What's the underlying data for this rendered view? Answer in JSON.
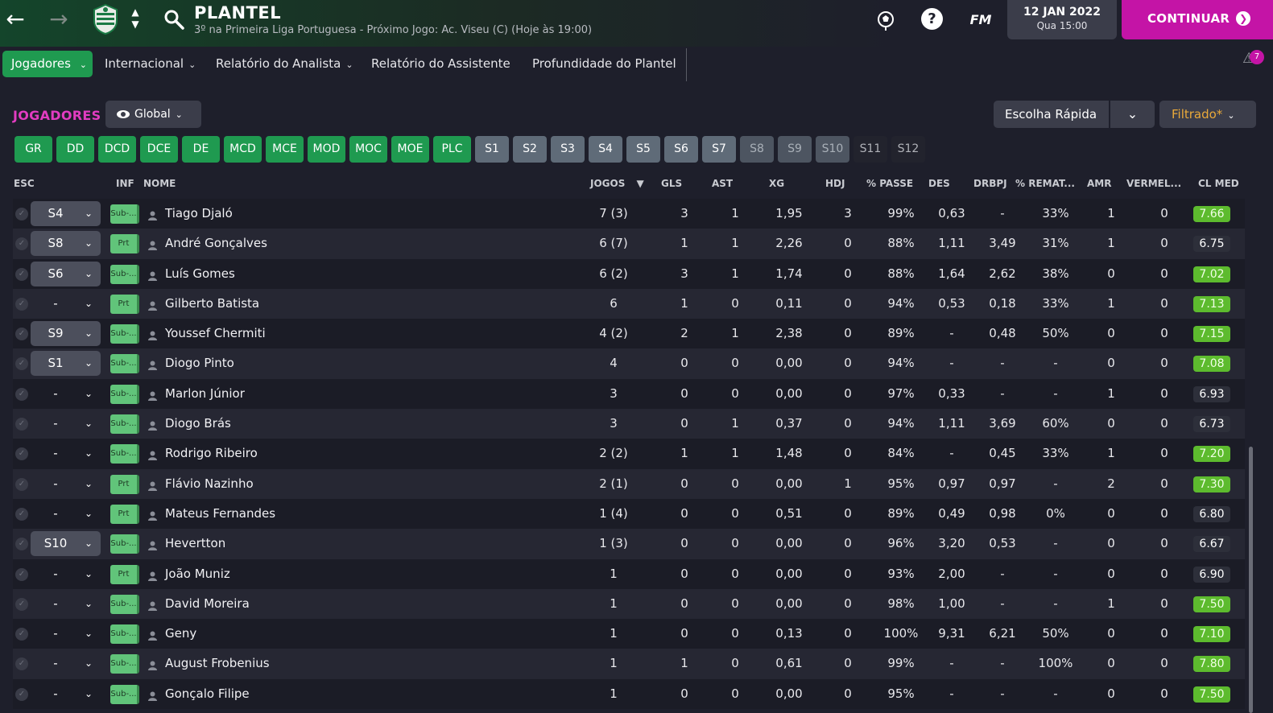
{
  "header": {
    "title": "PLANTEL",
    "subtitle": "3º na Primeira Liga Portuguesa - Próximo Jogo: Ac. Viseu (C) (Hoje às 19:00)",
    "fm_logo": "FM",
    "help": "?",
    "date": "12 JAN 2022",
    "time": "Qua 15:00",
    "continue_label": "CONTINUAR"
  },
  "nav": {
    "tabs": [
      {
        "label": "Jogadores"
      },
      {
        "label": "Internacional"
      },
      {
        "label": "Relatório do Analista"
      },
      {
        "label": "Relatório do Assistente"
      },
      {
        "label": "Profundidade do Plantel"
      }
    ],
    "notification_count": "7"
  },
  "filters": {
    "section_label": "JOGADORES",
    "view": "Global",
    "quick_pick": "Escolha Rápida",
    "filter_label": "Filtrado*",
    "positions": [
      "GR",
      "DD",
      "DCD",
      "DCE",
      "DE",
      "MCD",
      "MCE",
      "MOD",
      "MOC",
      "MOE",
      "PLC"
    ],
    "squads": [
      "S1",
      "S2",
      "S3",
      "S4",
      "S5",
      "S6",
      "S7",
      "S8",
      "S9",
      "S10",
      "S11",
      "S12"
    ]
  },
  "table": {
    "headers": {
      "esc": "ESC",
      "inf": "INF",
      "nome": "NOME",
      "jogos": "JOGOS",
      "gls": "GLS",
      "ast": "AST",
      "xg": "XG",
      "hdj": "HDJ",
      "passe": "% PASSE",
      "des": "DES",
      "drbpj": "DRBPJ",
      "remat": "% REMAT...",
      "amr": "AMR",
      "verm": "VERMEL...",
      "clmed": "CL MED"
    },
    "rows": [
      {
        "esc": "S4",
        "inf": "Sub-...",
        "name": "Tiago Djaló",
        "jogos": "7 (3)",
        "gls": "3",
        "ast": "1",
        "xg": "1,95",
        "hdj": "3",
        "passe": "99%",
        "des": "0,63",
        "drbpj": "-",
        "remat": "33%",
        "amr": "1",
        "verm": "0",
        "cl": "7.66"
      },
      {
        "esc": "S8",
        "inf": "Prt",
        "name": "André Gonçalves",
        "jogos": "6 (7)",
        "gls": "1",
        "ast": "1",
        "xg": "2,26",
        "hdj": "0",
        "passe": "88%",
        "des": "1,11",
        "drbpj": "3,49",
        "remat": "31%",
        "amr": "1",
        "verm": "0",
        "cl": "6.75"
      },
      {
        "esc": "S6",
        "inf": "Sub-...",
        "name": "Luís Gomes",
        "jogos": "6 (2)",
        "gls": "3",
        "ast": "1",
        "xg": "1,74",
        "hdj": "0",
        "passe": "88%",
        "des": "1,64",
        "drbpj": "2,62",
        "remat": "38%",
        "amr": "0",
        "verm": "0",
        "cl": "7.02"
      },
      {
        "esc": "-",
        "inf": "Prt",
        "name": "Gilberto Batista",
        "jogos": "6",
        "gls": "1",
        "ast": "0",
        "xg": "0,11",
        "hdj": "0",
        "passe": "94%",
        "des": "0,53",
        "drbpj": "0,18",
        "remat": "33%",
        "amr": "1",
        "verm": "0",
        "cl": "7.13"
      },
      {
        "esc": "S9",
        "inf": "Sub-...",
        "name": "Youssef Chermiti",
        "jogos": "4 (2)",
        "gls": "2",
        "ast": "1",
        "xg": "2,38",
        "hdj": "0",
        "passe": "89%",
        "des": "-",
        "drbpj": "0,48",
        "remat": "50%",
        "amr": "0",
        "verm": "0",
        "cl": "7.15"
      },
      {
        "esc": "S1",
        "inf": "Sub-...",
        "name": "Diogo Pinto",
        "jogos": "4",
        "gls": "0",
        "ast": "0",
        "xg": "0,00",
        "hdj": "0",
        "passe": "94%",
        "des": "-",
        "drbpj": "-",
        "remat": "-",
        "amr": "0",
        "verm": "0",
        "cl": "7.08"
      },
      {
        "esc": "-",
        "inf": "Sub-...",
        "name": "Marlon Júnior",
        "jogos": "3",
        "gls": "0",
        "ast": "0",
        "xg": "0,00",
        "hdj": "0",
        "passe": "97%",
        "des": "0,33",
        "drbpj": "-",
        "remat": "-",
        "amr": "1",
        "verm": "0",
        "cl": "6.93"
      },
      {
        "esc": "-",
        "inf": "Sub-...",
        "name": "Diogo Brás",
        "jogos": "3",
        "gls": "0",
        "ast": "1",
        "xg": "0,37",
        "hdj": "0",
        "passe": "94%",
        "des": "1,11",
        "drbpj": "3,69",
        "remat": "60%",
        "amr": "0",
        "verm": "0",
        "cl": "6.73"
      },
      {
        "esc": "-",
        "inf": "Sub-...",
        "name": "Rodrigo Ribeiro",
        "jogos": "2 (2)",
        "gls": "1",
        "ast": "1",
        "xg": "1,48",
        "hdj": "0",
        "passe": "84%",
        "des": "-",
        "drbpj": "0,45",
        "remat": "33%",
        "amr": "1",
        "verm": "0",
        "cl": "7.20"
      },
      {
        "esc": "-",
        "inf": "Prt",
        "name": "Flávio Nazinho",
        "jogos": "2 (1)",
        "gls": "0",
        "ast": "0",
        "xg": "0,00",
        "hdj": "1",
        "passe": "95%",
        "des": "0,97",
        "drbpj": "0,97",
        "remat": "-",
        "amr": "2",
        "verm": "0",
        "cl": "7.30"
      },
      {
        "esc": "-",
        "inf": "Prt",
        "name": "Mateus Fernandes",
        "jogos": "1 (4)",
        "gls": "0",
        "ast": "0",
        "xg": "0,51",
        "hdj": "0",
        "passe": "89%",
        "des": "0,49",
        "drbpj": "0,98",
        "remat": "0%",
        "amr": "0",
        "verm": "0",
        "cl": "6.80"
      },
      {
        "esc": "S10",
        "inf": "Sub-...",
        "name": "Hevertton",
        "jogos": "1 (3)",
        "gls": "0",
        "ast": "0",
        "xg": "0,00",
        "hdj": "0",
        "passe": "96%",
        "des": "3,20",
        "drbpj": "0,53",
        "remat": "-",
        "amr": "0",
        "verm": "0",
        "cl": "6.67"
      },
      {
        "esc": "-",
        "inf": "Prt",
        "name": "João Muniz",
        "jogos": "1",
        "gls": "0",
        "ast": "0",
        "xg": "0,00",
        "hdj": "0",
        "passe": "93%",
        "des": "2,00",
        "drbpj": "-",
        "remat": "-",
        "amr": "0",
        "verm": "0",
        "cl": "6.90"
      },
      {
        "esc": "-",
        "inf": "Sub-...",
        "name": "David Moreira",
        "jogos": "1",
        "gls": "0",
        "ast": "0",
        "xg": "0,00",
        "hdj": "0",
        "passe": "98%",
        "des": "1,00",
        "drbpj": "-",
        "remat": "-",
        "amr": "1",
        "verm": "0",
        "cl": "7.50"
      },
      {
        "esc": "-",
        "inf": "Sub-...",
        "name": "Geny",
        "jogos": "1",
        "gls": "0",
        "ast": "0",
        "xg": "0,13",
        "hdj": "0",
        "passe": "100%",
        "des": "9,31",
        "drbpj": "6,21",
        "remat": "50%",
        "amr": "0",
        "verm": "0",
        "cl": "7.10"
      },
      {
        "esc": "-",
        "inf": "Sub-...",
        "name": "August Frobenius",
        "jogos": "1",
        "gls": "1",
        "ast": "0",
        "xg": "0,61",
        "hdj": "0",
        "passe": "99%",
        "des": "-",
        "drbpj": "-",
        "remat": "100%",
        "amr": "0",
        "verm": "0",
        "cl": "7.80"
      },
      {
        "esc": "-",
        "inf": "Sub-...",
        "name": "Gonçalo Filipe",
        "jogos": "1",
        "gls": "0",
        "ast": "0",
        "xg": "0,00",
        "hdj": "0",
        "passe": "95%",
        "des": "-",
        "drbpj": "-",
        "remat": "-",
        "amr": "0",
        "verm": "0",
        "cl": "7.50"
      }
    ]
  },
  "colors": {
    "accent_magenta": "#c414a6",
    "accent_green": "#1f9a50",
    "rating_good": "#5dbb2e",
    "filter_orange": "#e9a93a"
  }
}
